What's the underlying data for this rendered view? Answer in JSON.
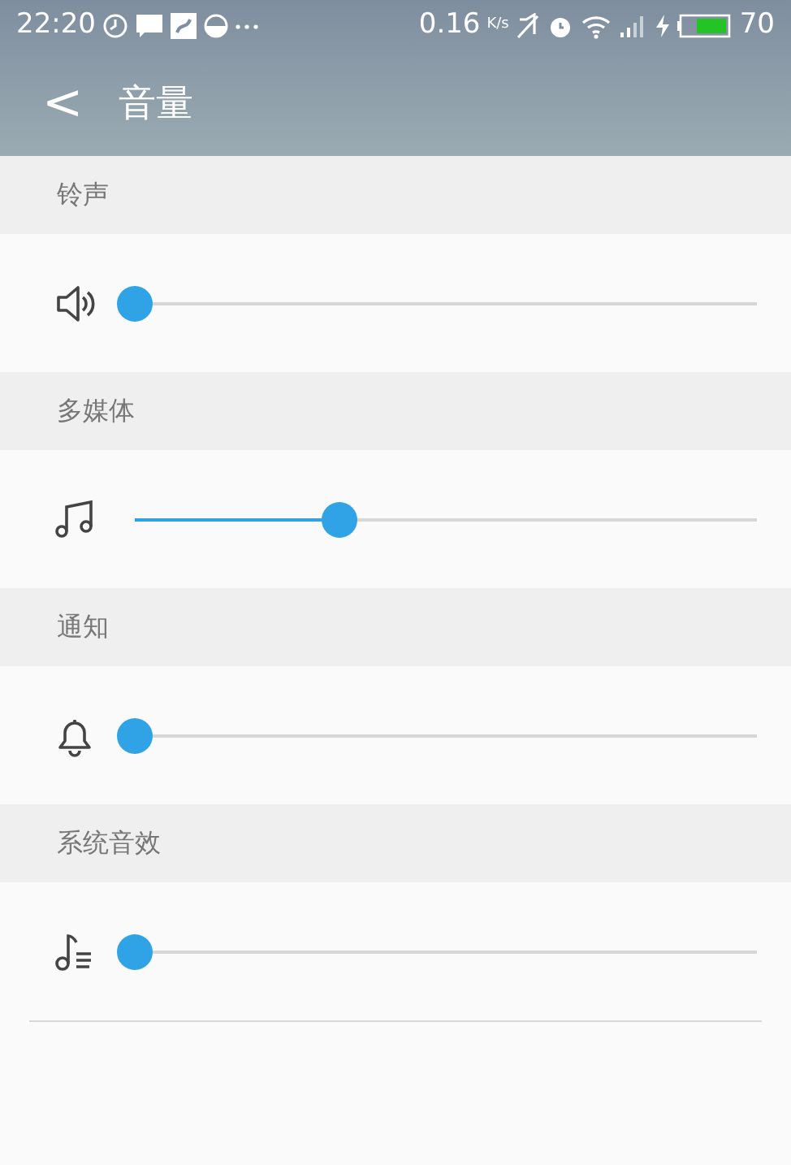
{
  "status_bar": {
    "time": "22:20",
    "speed": "0.16",
    "speed_unit": "K/s",
    "battery": "70"
  },
  "header": {
    "back": "<",
    "title": "音量"
  },
  "sections": [
    {
      "title": "铃声",
      "kind": "ringtone",
      "level": 0
    },
    {
      "title": "多媒体",
      "kind": "media",
      "level": 0.33
    },
    {
      "title": "通知",
      "kind": "notification",
      "level": 0
    },
    {
      "title": "系统音效",
      "kind": "system",
      "level": 0
    }
  ]
}
